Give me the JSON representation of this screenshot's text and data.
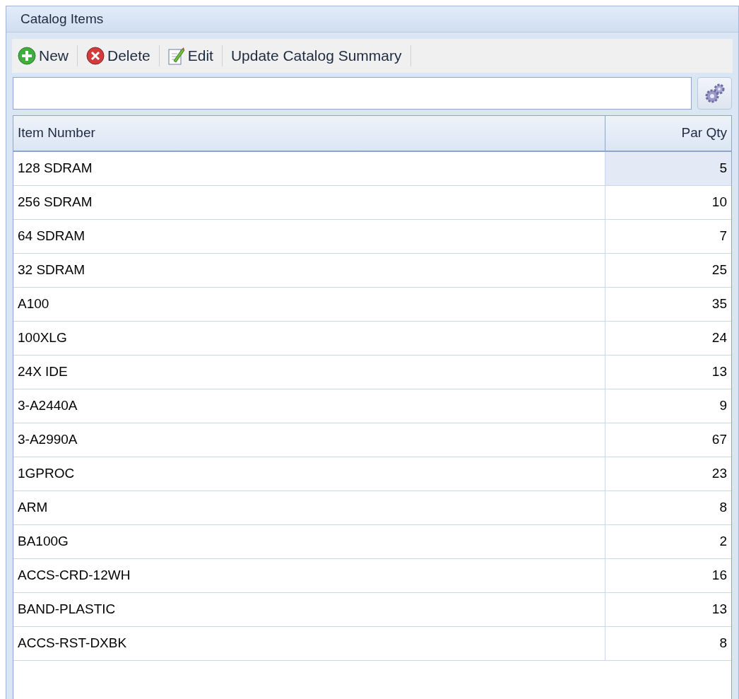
{
  "panel": {
    "title": "Catalog Items"
  },
  "toolbar": [
    {
      "kind": "new",
      "label": "New"
    },
    {
      "kind": "delete",
      "label": "Delete"
    },
    {
      "kind": "edit",
      "label": "Edit"
    },
    {
      "kind": "plain",
      "label": "Update Catalog Summary"
    }
  ],
  "table": {
    "columns": [
      "Item Number",
      "Par Qty"
    ],
    "rows": [
      {
        "item": "128 SDRAM",
        "qty": "5",
        "focused": true
      },
      {
        "item": "256 SDRAM",
        "qty": "10",
        "focused": false
      },
      {
        "item": "64 SDRAM",
        "qty": "7",
        "focused": false
      },
      {
        "item": "32 SDRAM",
        "qty": "25",
        "focused": false
      },
      {
        "item": "A100",
        "qty": "35",
        "focused": false
      },
      {
        "item": "100XLG",
        "qty": "24",
        "focused": false
      },
      {
        "item": "24X IDE",
        "qty": "13",
        "focused": false
      },
      {
        "item": "3-A2440A",
        "qty": "9",
        "focused": false
      },
      {
        "item": "3-A2990A",
        "qty": "67",
        "focused": false
      },
      {
        "item": "1GPROC",
        "qty": "23",
        "focused": false
      },
      {
        "item": "ARM",
        "qty": "8",
        "focused": false
      },
      {
        "item": "BA100G",
        "qty": "2",
        "focused": false
      },
      {
        "item": "ACCS-CRD-12WH",
        "qty": "16",
        "focused": false
      },
      {
        "item": "BAND-PLASTIC",
        "qty": "13",
        "focused": false
      },
      {
        "item": "ACCS-RST-DXBK",
        "qty": "8",
        "focused": false
      }
    ]
  }
}
